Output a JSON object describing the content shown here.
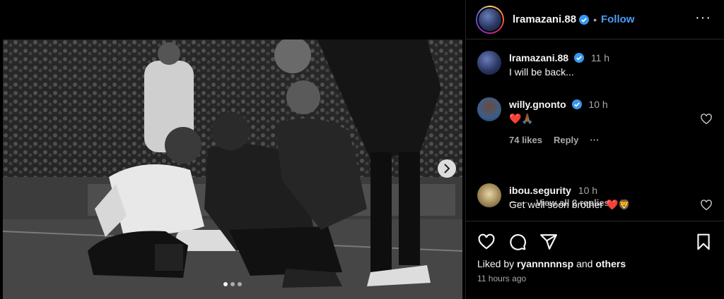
{
  "post": {
    "username": "lramazani.88",
    "follow_label": "Follow",
    "separator": "•",
    "more_label": "···",
    "media": {
      "photo_icon": "photo",
      "next_icon": "chevron-right-icon",
      "dots_count": 3,
      "active_dot": 0
    }
  },
  "comments": [
    {
      "user": "lramazani.88",
      "time": "11 h",
      "text": "I will be back...",
      "verified": true
    },
    {
      "user": "willy.gnonto",
      "time": "10 h",
      "text": "❤️🙏🏾",
      "verified": true,
      "likes": "74 likes",
      "reply": "Reply",
      "more": "···"
    },
    {
      "user": "ibou.segurity",
      "time": "10 h",
      "text": "Get well soon brother ❤️🦁",
      "verified": false
    }
  ],
  "view_replies": "View all 2 replies",
  "actions": {
    "icons": [
      "heart-icon",
      "comment-icon",
      "share-icon",
      "bookmark-icon"
    ]
  },
  "liked_by": {
    "prefix": "Liked by",
    "user": "ryannnnnsp",
    "and": "and",
    "others": "others"
  },
  "timestamp": "11 hours ago",
  "colors": {
    "accent": "#4a9df8",
    "verified": "#3897f0",
    "heart": "#e3253f"
  }
}
